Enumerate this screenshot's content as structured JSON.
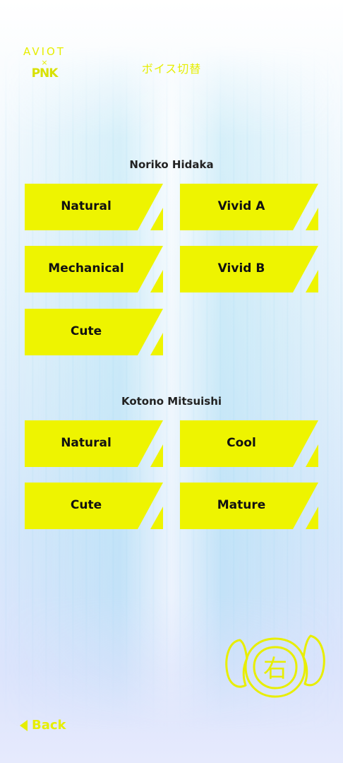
{
  "header": {
    "logo_top": "AVIOT",
    "logo_cross": "×",
    "logo_bottom": "PNK",
    "title": "ボイス切替"
  },
  "sections": [
    {
      "name": "Noriko Hidaka",
      "buttons": [
        "Natural",
        "Vivid A",
        "Mechanical",
        "Vivid B",
        "Cute"
      ]
    },
    {
      "name": "Kotono Mitsuishi",
      "buttons": [
        "Natural",
        "Cool",
        "Cute",
        "Mature"
      ]
    }
  ],
  "footer": {
    "back_label": "Back"
  },
  "mascot": {
    "character": "右",
    "icon": "mascot-face-icon"
  },
  "colors": {
    "accent": "#EEF400",
    "text": "#111111",
    "button_notch": "#FFFFFF"
  }
}
